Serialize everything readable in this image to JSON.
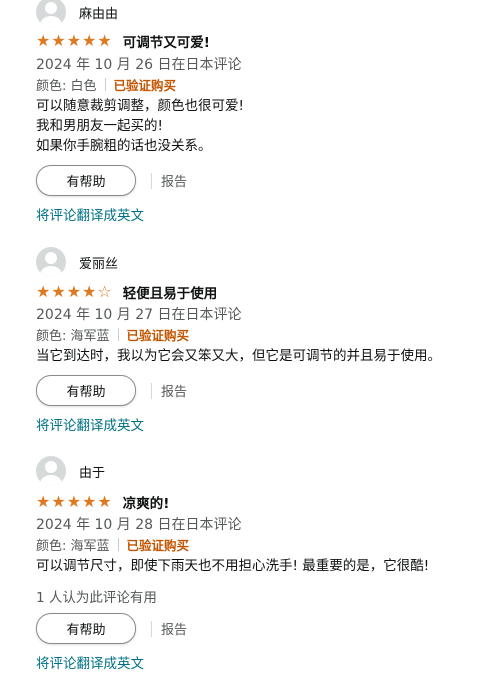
{
  "reviews": [
    {
      "username": "麻由由",
      "rating": 5,
      "title": "可调节又可爱!",
      "date": "2024 年 10 月 26 日在日本评论",
      "color_label": "颜色: 白色",
      "verified": "已验证购买",
      "body": [
        "可以随意裁剪调整，颜色也很可爱!",
        "我和男朋友一起买的!",
        "如果你手腕粗的话也没关系。"
      ],
      "helpful_count": "",
      "helpful_button": "有帮助",
      "report": "报告",
      "translate": "将评论翻译成英文"
    },
    {
      "username": "爱丽丝",
      "rating": 4,
      "title": "轻便且易于使用",
      "date": "2024 年 10 月 27 日在日本评论",
      "color_label": "颜色: 海军蓝",
      "verified": "已验证购买",
      "body": [
        "当它到达时，我以为它会又笨又大，但它是可调节的并且易于使用。"
      ],
      "helpful_count": "",
      "helpful_button": "有帮助",
      "report": "报告",
      "translate": "将评论翻译成英文"
    },
    {
      "username": "由于",
      "rating": 5,
      "title": "凉爽的!",
      "date": "2024 年 10 月 28 日在日本评论",
      "color_label": "颜色: 海军蓝",
      "verified": "已验证购买",
      "body": [
        "可以调节尺寸，即使下雨天也不用担心洗手! 最重要的是，它很酷!"
      ],
      "helpful_count": "1 人认为此评论有用",
      "helpful_button": "有帮助",
      "report": "报告",
      "translate": "将评论翻译成英文"
    }
  ],
  "colors": {
    "star": "#de7921",
    "verified": "#c45500",
    "link": "#007185",
    "muted": "#565959"
  },
  "icons": {
    "avatar": "user-avatar-icon",
    "star": "star-icon"
  }
}
